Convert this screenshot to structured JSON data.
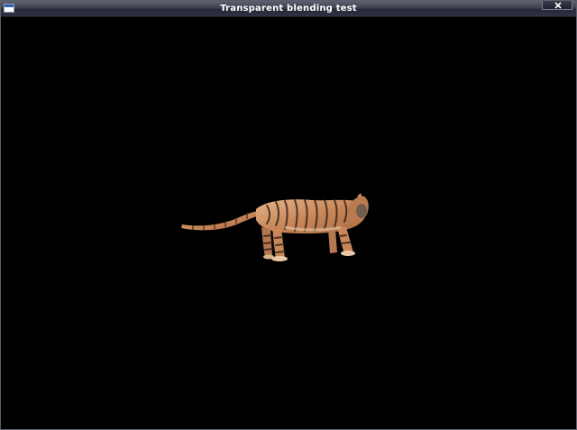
{
  "window": {
    "title": "Transparent blending test",
    "close_icon": "close-icon",
    "app_icon": "window-icon"
  },
  "viewport": {
    "background": "#000000",
    "subject": "tiger-model"
  },
  "colors": {
    "titlebar_top": "#5d6170",
    "titlebar_bottom": "#26293a",
    "tiger_base": "#c8875a",
    "tiger_light": "#e3b58a",
    "tiger_stripe": "#3a2418"
  }
}
